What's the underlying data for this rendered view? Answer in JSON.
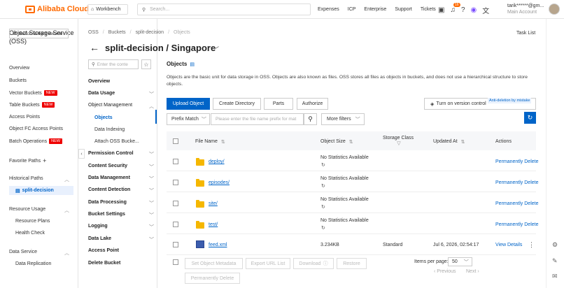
{
  "topbar": {
    "brand": "Alibaba Cloud",
    "workbench": "Workbench",
    "search_placeholder": "Search...",
    "nav": [
      "Expenses",
      "ICP",
      "Enterprise",
      "Support",
      "Tickets"
    ],
    "notif_count": "16",
    "user_name": "tarik******@gm...",
    "user_role": "Main Account"
  },
  "sidebar": {
    "title": "Object Storage Service (OSS)",
    "switch_label": "Switch to light version",
    "overview": "Overview",
    "buckets": "Buckets",
    "vector_buckets": "Vector Buckets",
    "table_buckets": "Table Buckets",
    "new_badge": "NEW",
    "access_points": "Access Points",
    "object_fc": "Object FC Access Points",
    "batch_ops": "Batch Operations",
    "favorite_paths": "Favorite Paths",
    "historical_paths": "Historical Paths",
    "historical_item": "split-decision",
    "resource_usage": "Resource Usage",
    "resource_plans": "Resource Plans",
    "health_check": "Health Check",
    "data_service": "Data Service",
    "data_replication": "Data Replication"
  },
  "bucketnav": {
    "filter_placeholder": "Enter the conte",
    "overview": "Overview",
    "data_usage": "Data Usage",
    "object_management": "Object Management",
    "objects": "Objects",
    "data_indexing": "Data Indexing",
    "attach_oss": "Attach OSS Bucke...",
    "permission_control": "Permission Control",
    "content_security": "Content Security",
    "data_management": "Data Management",
    "content_detection": "Content Detection",
    "data_processing": "Data Processing",
    "bucket_settings": "Bucket Settings",
    "logging": "Logging",
    "data_lake": "Data Lake",
    "access_point": "Access Point",
    "delete_bucket": "Delete Bucket"
  },
  "breadcrumb": [
    "OSS",
    "Buckets",
    "split-decision",
    "Objects"
  ],
  "task_list": "Task List",
  "page_title": "split-decision / Singapore",
  "objects": {
    "title": "Objects",
    "description": "Objects are the basic unit for data storage in OSS. Objects are also known as files. OSS stores all files as objects in buckets, and does not use a hierarchical structure to store objects.",
    "upload": "Upload Object",
    "create_dir": "Create Directory",
    "parts": "Parts",
    "authorize": "Authorize",
    "versioning": "Turn on version control",
    "anti_deletion": "Anti-deletion by mistake",
    "prefix_match": "Prefix Match",
    "prefix_placeholder": "Please enter the file name prefix for mat",
    "more_filters": "More filters"
  },
  "table": {
    "headers": [
      "File Name",
      "Object Size",
      "Storage Class",
      "Updated At",
      "Actions"
    ],
    "rows": [
      {
        "name": "deploy/",
        "size": "No Statistics Available",
        "class": "",
        "updated": "",
        "action": "Permanently Delete"
      },
      {
        "name": "episodes/",
        "size": "No Statistics Available",
        "class": "",
        "updated": "",
        "action": "Permanently Delete"
      },
      {
        "name": "site/",
        "size": "No Statistics Available",
        "class": "",
        "updated": "",
        "action": "Permanently Delete"
      },
      {
        "name": "test/",
        "size": "No Statistics Available",
        "class": "",
        "updated": "",
        "action": "Permanently Delete"
      },
      {
        "name": "feed.xml",
        "size": "3.234KB",
        "class": "Standard",
        "updated": "Jul 6, 2026, 02:54:17",
        "action": "View Details"
      }
    ]
  },
  "footer": {
    "set_metadata": "Set Object Metadata",
    "export_url": "Export URL List",
    "download": "Download",
    "restore": "Restore",
    "perm_delete": "Permanently Delete",
    "items_per_page": "Items per page:",
    "page_size": "50",
    "previous": "Previous",
    "next": "Next"
  }
}
